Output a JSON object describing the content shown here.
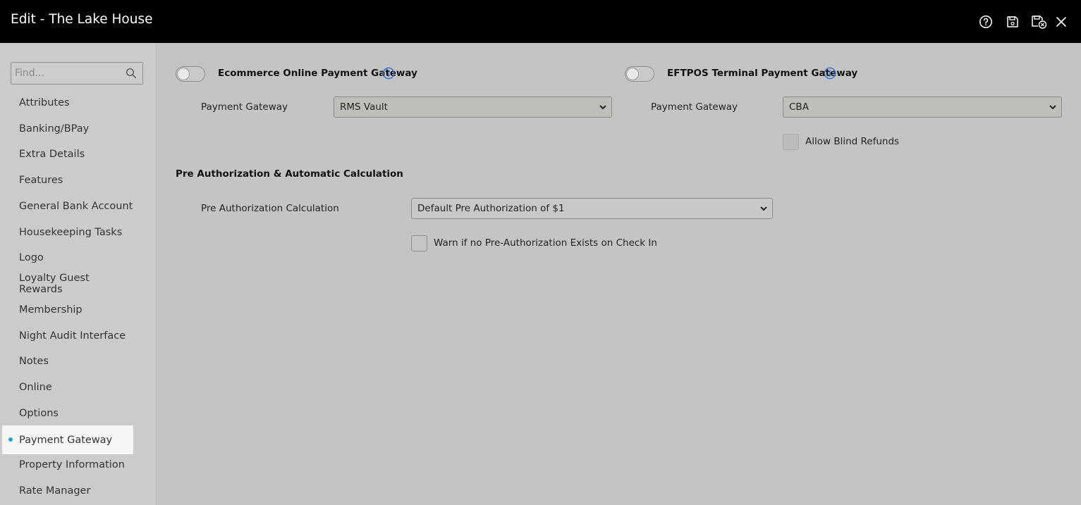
{
  "window": {
    "title": "Edit - The Lake House"
  },
  "toolbar": {
    "icons": [
      "help-icon",
      "save-icon",
      "save-and-close-icon",
      "close-icon"
    ]
  },
  "sidebar": {
    "search_placeholder": "Find...",
    "items": [
      {
        "label": "Attributes"
      },
      {
        "label": "Banking/BPay"
      },
      {
        "label": "Extra Details"
      },
      {
        "label": "Features"
      },
      {
        "label": "General Bank Account"
      },
      {
        "label": "Housekeeping Tasks"
      },
      {
        "label": "Logo"
      },
      {
        "label": "Loyalty Guest Rewards"
      },
      {
        "label": "Membership"
      },
      {
        "label": "Night Audit Interface"
      },
      {
        "label": "Notes"
      },
      {
        "label": "Online"
      },
      {
        "label": "Options"
      },
      {
        "label": "Payment Gateway",
        "active": true
      },
      {
        "label": "Property Information"
      },
      {
        "label": "Rate Manager"
      }
    ]
  },
  "ecommerce": {
    "toggle_label": "Ecommerce Online Payment Gateway",
    "enabled": false,
    "gateway_label": "Payment Gateway",
    "gateway_value": "RMS Vault"
  },
  "eftpos": {
    "toggle_label": "EFTPOS Terminal Payment Gateway",
    "enabled": false,
    "gateway_label": "Payment Gateway",
    "gateway_value": "CBA",
    "blind_refunds_label": "Allow Blind Refunds",
    "blind_refunds_checked": false
  },
  "preauth": {
    "section_title": "Pre Authorization & Automatic Calculation",
    "calc_label": "Pre Authorization Calculation",
    "calc_value": "Default Pre Authorization of $1",
    "warn_label": "Warn if no Pre-Authorization Exists on Check In",
    "warn_checked": false
  },
  "colors": {
    "titlebar": "#000000",
    "accent_dot": "#1aa8c9",
    "info_icon": "#2f6fd6"
  }
}
